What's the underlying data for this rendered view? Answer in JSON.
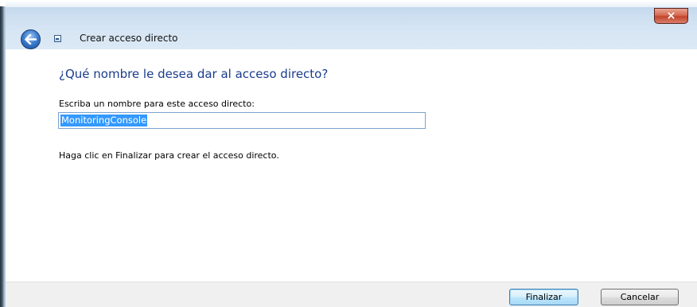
{
  "window": {
    "title": "Crear acceso directo",
    "close_glyph": "×",
    "back_icon": "back-arrow-icon",
    "wizard_icon": "shortcut-wizard-icon"
  },
  "main": {
    "heading": "¿Qué nombre le desea dar al acceso directo?",
    "name_label": "Escriba un nombre para este acceso directo:",
    "name_value": "MonitoringConsole",
    "hint": "Haga clic en Finalizar para crear el acceso directo."
  },
  "footer": {
    "finish_label": "Finalizar",
    "cancel_label": "Cancelar"
  },
  "colors": {
    "heading": "#1a3c8e",
    "selection": "#3399ff",
    "close_button": "#c3442c",
    "glass": "#c9dcef"
  }
}
